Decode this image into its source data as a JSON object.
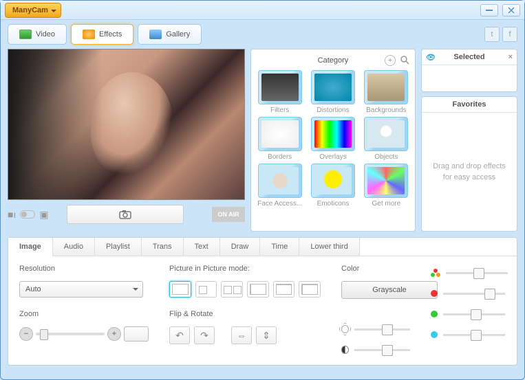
{
  "app_name": "ManyCam",
  "main_tabs": {
    "video": "Video",
    "effects": "Effects",
    "gallery": "Gallery"
  },
  "onair": "ON AIR",
  "category": {
    "title": "Category",
    "items": [
      "Filters",
      "Distortions",
      "Backgrounds",
      "Borders",
      "Overlays",
      "Objects",
      "Face Access...",
      "Emoticons",
      "Get more"
    ]
  },
  "selected": {
    "title": "Selected"
  },
  "favorites": {
    "title": "Favorites",
    "hint": "Drag and drop effects for easy access"
  },
  "bottom_tabs": [
    "Image",
    "Audio",
    "Playlist",
    "Trans",
    "Text",
    "Draw",
    "Time",
    "Lower third"
  ],
  "image_panel": {
    "resolution_lbl": "Resolution",
    "resolution_val": "Auto",
    "zoom_lbl": "Zoom",
    "pip_lbl": "Picture in Picture mode:",
    "flip_lbl": "Flip & Rotate",
    "color_lbl": "Color",
    "grayscale": "Grayscale"
  }
}
